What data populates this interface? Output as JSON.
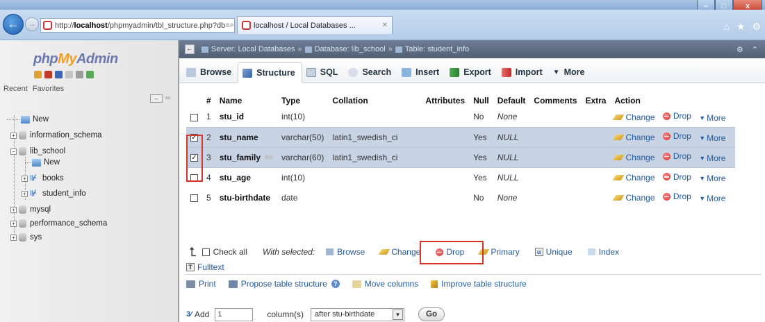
{
  "browser": {
    "url_prefix": "http://",
    "url_host": "localhost",
    "url_path": "/phpmyadmin/tbl_structure.php?db=",
    "tab_title": "localhost / Local Databases ..."
  },
  "sidebar": {
    "logo_php": "php",
    "logo_my": "My",
    "logo_admin": "Admin",
    "recent_label": "Recent",
    "favorites_label": "Favorites",
    "tree": [
      {
        "label": "New"
      },
      {
        "label": "information_schema"
      },
      {
        "label": "lib_school"
      },
      {
        "label": "New"
      },
      {
        "label": "books"
      },
      {
        "label": "student_info"
      },
      {
        "label": "mysql"
      },
      {
        "label": "performance_schema"
      },
      {
        "label": "sys"
      }
    ]
  },
  "breadcrumb": {
    "server": "Server: Local Databases",
    "database": "Database: lib_school",
    "table": "Table: student_info"
  },
  "tabs": [
    "Browse",
    "Structure",
    "SQL",
    "Search",
    "Insert",
    "Export",
    "Import",
    "More"
  ],
  "table": {
    "headers": [
      "#",
      "Name",
      "Type",
      "Collation",
      "Attributes",
      "Null",
      "Default",
      "Comments",
      "Extra",
      "Action"
    ],
    "rows": [
      {
        "num": "1",
        "name": "stu_id",
        "type": "int(10)",
        "collation": "",
        "null": "No",
        "default": "None"
      },
      {
        "num": "2",
        "name": "stu_name",
        "type": "varchar(50)",
        "collation": "latin1_swedish_ci",
        "null": "Yes",
        "default": "NULL"
      },
      {
        "num": "3",
        "name": "stu_family",
        "type": "varchar(60)",
        "collation": "latin1_swedish_ci",
        "null": "Yes",
        "default": "NULL"
      },
      {
        "num": "4",
        "name": "stu_age",
        "type": "int(10)",
        "collation": "",
        "null": "Yes",
        "default": "NULL"
      },
      {
        "num": "5",
        "name": "stu-birthdate",
        "type": "date",
        "collation": "",
        "null": "No",
        "default": "None"
      }
    ],
    "action_change": "Change",
    "action_drop": "Drop",
    "action_more": "More"
  },
  "with_selected": {
    "check_all": "Check all",
    "with_selected": "With selected:",
    "browse": "Browse",
    "change": "Change",
    "drop": "Drop",
    "primary": "Primary",
    "unique": "Unique",
    "index": "Index",
    "fulltext": "Fulltext"
  },
  "tools": {
    "print": "Print",
    "propose": "Propose table structure",
    "move": "Move columns",
    "improve": "Improve table structure"
  },
  "add_column": {
    "add_label": "Add",
    "count": "1",
    "columns_label": "column(s)",
    "position": "after stu-birthdate",
    "go": "Go"
  }
}
